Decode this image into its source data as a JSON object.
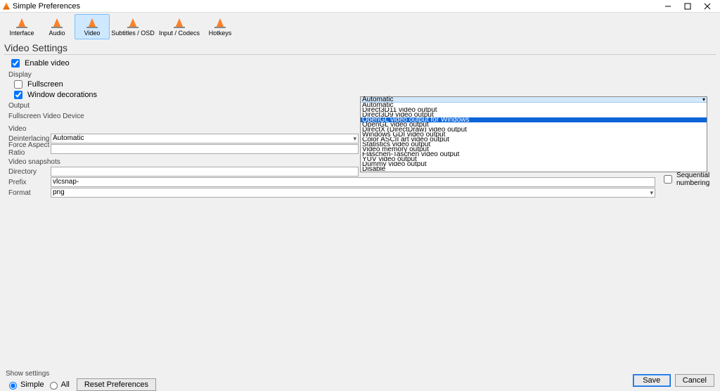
{
  "window": {
    "title": "Simple Preferences"
  },
  "toolbar": {
    "items": [
      {
        "label": "Interface"
      },
      {
        "label": "Audio"
      },
      {
        "label": "Video",
        "selected": true
      },
      {
        "label": "Subtitles / OSD"
      },
      {
        "label": "Input / Codecs"
      },
      {
        "label": "Hotkeys"
      }
    ]
  },
  "section_title": "Video Settings",
  "enable_video_label": "Enable video",
  "groups": {
    "display": {
      "label": "Display",
      "fullscreen_label": "Fullscreen",
      "window_decorations_label": "Window decorations",
      "output_label": "Output",
      "fullscreen_device_label": "Fullscreen Video Device"
    },
    "video": {
      "label": "Video",
      "deinterlacing_label": "Deinterlacing",
      "deinterlacing_value": "Automatic",
      "force_aspect_label": "Force Aspect Ratio",
      "force_aspect_value": ""
    },
    "snapshots": {
      "label": "Video snapshots",
      "directory_label": "Directory",
      "directory_value": "",
      "prefix_label": "Prefix",
      "prefix_value": "vlcsnap-",
      "sequential_label": "Sequential numbering",
      "format_label": "Format",
      "format_value": "png"
    }
  },
  "dropdown": {
    "header": "Automatic",
    "options": [
      "Automatic",
      "Direct3D11 video output",
      "Direct3D9 video output",
      "OpenGL video output for Windows",
      "OpenGL video output",
      "DirectX (DirectDraw) video output",
      "Windows GDI video output",
      "Color ASCII art video output",
      "Statistics video output",
      "Video memory output",
      "Flaschen-Taschen video output",
      "YUV video output",
      "Dummy video output",
      "Disable"
    ],
    "highlighted_index": 3
  },
  "bottom": {
    "show_settings_label": "Show settings",
    "radio_simple_label": "Simple",
    "radio_all_label": "All",
    "reset_label": "Reset Preferences",
    "save_label": "Save",
    "cancel_label": "Cancel"
  }
}
